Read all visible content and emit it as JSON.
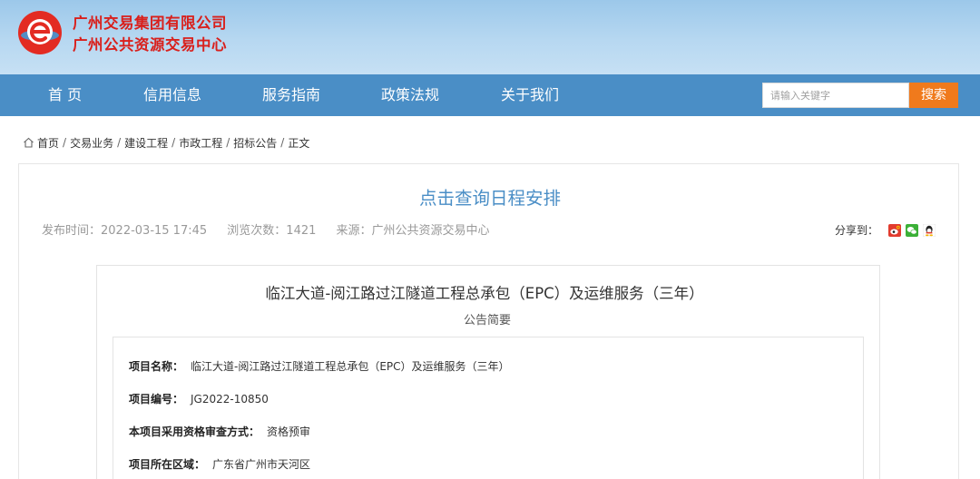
{
  "header": {
    "org_name_1": "广州交易集团有限公司",
    "org_name_2": "广州公共资源交易中心",
    "logo_icon": "e-logo-icon"
  },
  "nav": {
    "items": [
      "首 页",
      "信用信息",
      "服务指南",
      "政策法规",
      "关于我们"
    ],
    "search_placeholder": "请输入关键字",
    "search_label": "搜索"
  },
  "breadcrumb": {
    "items": [
      "首页",
      "交易业务",
      "建设工程",
      "市政工程",
      "招标公告",
      "正文"
    ],
    "separator": "/"
  },
  "article": {
    "title": "点击查询日程安排",
    "publish_time": "发布时间：2022-03-15 17:45",
    "views": "浏览次数：1421",
    "source": "来源：广州公共资源交易中心",
    "share_label": "分享到："
  },
  "notice": {
    "project_title": "临江大道-阅江路过江隧道工程总承包（EPC）及运维服务（三年）",
    "summary_label": "公告简要",
    "rows": [
      {
        "key": "项目名称：",
        "value": "临江大道-阅江路过江隧道工程总承包（EPC）及运维服务（三年）"
      },
      {
        "key": "项目编号：",
        "value": "JG2022-10850"
      },
      {
        "key": "本项目采用资格审查方式：",
        "value": "资格预审"
      },
      {
        "key": "项目所在区域：",
        "value": "广东省广州市天河区"
      }
    ]
  },
  "colors": {
    "nav_bg": "#4a8ec6",
    "org_red": "#d9201c",
    "search_orange": "#f07a1c",
    "title_blue": "#4a8ec6"
  }
}
